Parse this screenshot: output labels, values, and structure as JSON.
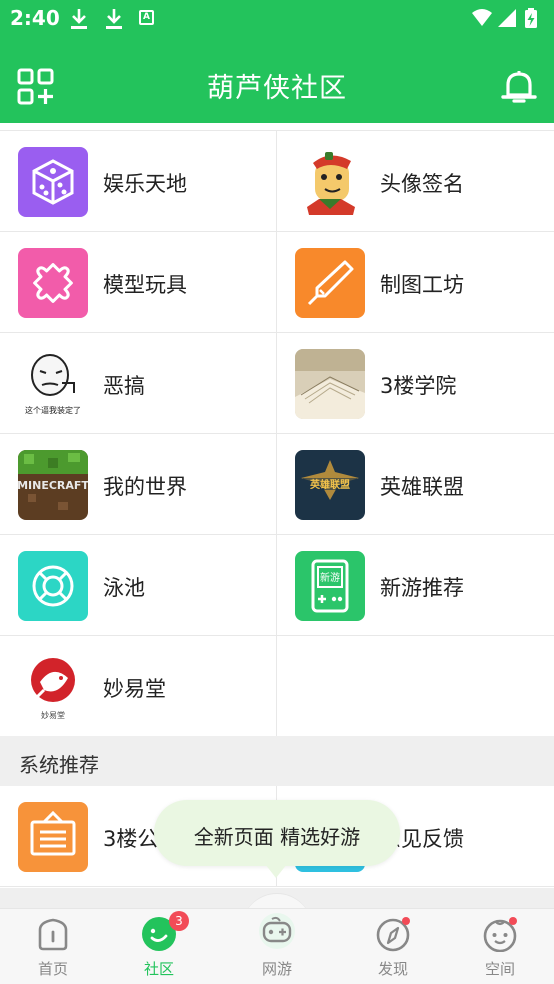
{
  "status_bar": {
    "time": "2:40",
    "icons": [
      "download-icon",
      "download-icon",
      "font-a-icon",
      "wifi-icon",
      "signal-icon",
      "battery-charging-icon"
    ]
  },
  "header": {
    "title": "葫芦侠社区",
    "left_icon": "grid-add-icon",
    "right_icon": "bell-icon"
  },
  "categories": [
    {
      "label": "娱乐天地",
      "icon": "dice-icon",
      "color": "#9a5ef0"
    },
    {
      "label": "头像签名",
      "icon": "cartoon-avatar-icon",
      "color": "#ffffff"
    },
    {
      "label": "模型玩具",
      "icon": "puzzle-icon",
      "color": "#f25caa"
    },
    {
      "label": "制图工坊",
      "icon": "pen-nib-icon",
      "color": "#f8892b"
    },
    {
      "label": "恶搞",
      "icon": "meme-face-icon",
      "color": "#ffffff",
      "caption": "这个逼我装定了"
    },
    {
      "label": "3楼学院",
      "icon": "open-book-icon",
      "color": "#d9cfb8"
    },
    {
      "label": "我的世界",
      "icon": "minecraft-icon",
      "color": "#5c3d22",
      "caption": "MINECRAFT"
    },
    {
      "label": "英雄联盟",
      "icon": "lol-icon",
      "color": "#1c3346",
      "caption": "英雄联盟"
    },
    {
      "label": "泳池",
      "icon": "lifebuoy-icon",
      "color": "#2cd6c5"
    },
    {
      "label": "新游推荐",
      "icon": "gameboy-icon",
      "color": "#2bc56a",
      "caption": "新游"
    },
    {
      "label": "妙易堂",
      "icon": "fish-logo-icon",
      "color": "#ffffff",
      "caption": "妙易堂"
    }
  ],
  "section_title": "系统推荐",
  "recommend": [
    {
      "label": "3楼公告",
      "icon": "sign-board-icon",
      "color": "#f7933a"
    },
    {
      "label": "意见反馈",
      "icon": "feedback-icon",
      "color": "#2fc0e0"
    }
  ],
  "toast": {
    "text": "全新页面  精选好游"
  },
  "nav": [
    {
      "label": "首页",
      "icon": "home-icon",
      "active": false
    },
    {
      "label": "社区",
      "icon": "community-icon",
      "active": true,
      "badge": "3"
    },
    {
      "label": "网游",
      "icon": "gamepad-icon",
      "active": false
    },
    {
      "label": "发现",
      "icon": "compass-icon",
      "active": false,
      "dot": true
    },
    {
      "label": "空间",
      "icon": "face-icon",
      "active": false,
      "dot": true
    }
  ],
  "colors": {
    "brand": "#23c35c",
    "badge": "#f24b57"
  }
}
